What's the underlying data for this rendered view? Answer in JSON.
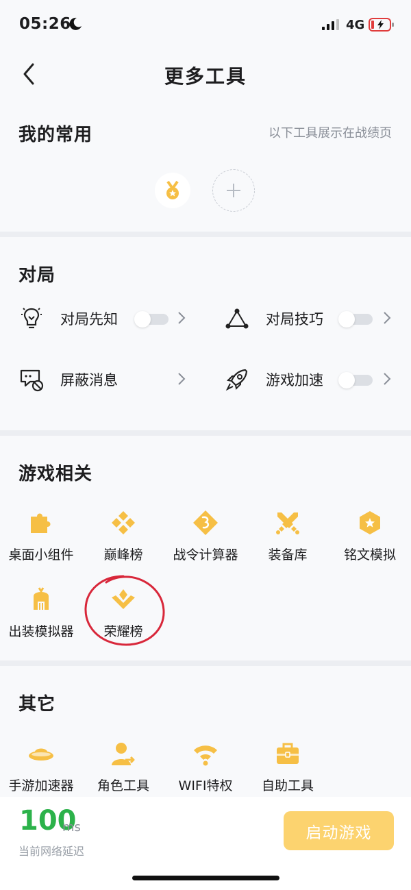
{
  "status_bar": {
    "time": "05:26",
    "network": "4G"
  },
  "nav": {
    "title": "更多工具"
  },
  "favorites": {
    "title": "我的常用",
    "hint": "以下工具展示在战绩页"
  },
  "match": {
    "title": "对局",
    "items": [
      {
        "label": "对局先知",
        "icon": "lightbulb-icon",
        "toggle": false
      },
      {
        "label": "对局技巧",
        "icon": "triangle-nodes-icon",
        "toggle": false
      },
      {
        "label": "屏蔽消息",
        "icon": "message-block-icon"
      },
      {
        "label": "游戏加速",
        "icon": "rocket-icon",
        "toggle": false
      }
    ]
  },
  "game": {
    "title": "游戏相关",
    "items": [
      {
        "label": "桌面小组件",
        "icon": "puzzle-icon"
      },
      {
        "label": "巅峰榜",
        "icon": "diamond-cluster-icon"
      },
      {
        "label": "战令计算器",
        "icon": "battle-pass-icon"
      },
      {
        "label": "装备库",
        "icon": "crossed-swords-icon"
      },
      {
        "label": "铭文模拟",
        "icon": "hexagon-star-icon"
      },
      {
        "label": "出装模拟器",
        "icon": "helmet-icon"
      },
      {
        "label": "荣耀榜",
        "icon": "honor-crest-icon"
      }
    ]
  },
  "other": {
    "title": "其它",
    "items": [
      {
        "label": "手游加速器",
        "icon": "ufo-icon"
      },
      {
        "label": "角色工具",
        "icon": "user-share-icon"
      },
      {
        "label": "WIFI特权",
        "icon": "wifi-icon"
      },
      {
        "label": "自助工具",
        "icon": "toolbox-icon"
      }
    ]
  },
  "bottom": {
    "latency_value": "100",
    "latency_unit": "ms",
    "latency_label": "当前网络延迟",
    "start_label": "启动游戏"
  },
  "colors": {
    "accent": "#fcd36f",
    "icon_gold": "#f6bf45",
    "latency_green": "#2cb24a",
    "annotation_red": "#d8273a"
  }
}
